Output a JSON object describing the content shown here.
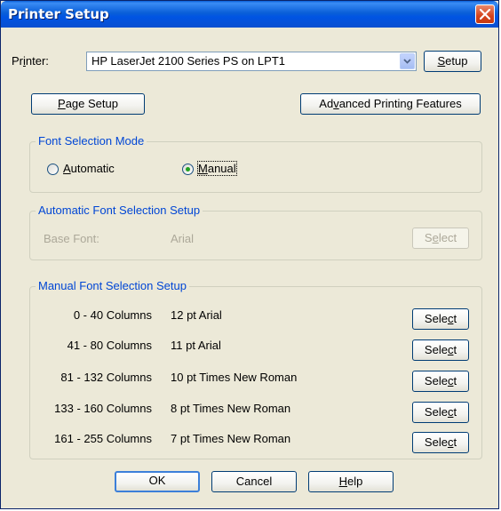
{
  "window": {
    "title": "Printer Setup"
  },
  "printer": {
    "label": "Printer:",
    "label_access": "i",
    "selected": "HP LaserJet 2100 Series PS on LPT1",
    "setup_button": "Setup"
  },
  "page_setup_button": "Page Setup",
  "advanced_button": "Advanced Printing Features",
  "font_mode": {
    "title": "Font Selection Mode",
    "options": [
      {
        "label": "Automatic",
        "selected": false
      },
      {
        "label": "Manual",
        "selected": true
      }
    ]
  },
  "auto_setup": {
    "title": "Automatic Font Selection Setup",
    "base_font_label": "Base Font:",
    "base_font_value": "Arial",
    "select_button": "Select"
  },
  "manual_setup": {
    "title": "Manual Font Selection Setup",
    "rows": [
      {
        "columns": "0 - 40 Columns",
        "font": "12 pt Arial",
        "button": "Select"
      },
      {
        "columns": "41 - 80 Columns",
        "font": "11 pt Arial",
        "button": "Select"
      },
      {
        "columns": "81 - 132 Columns",
        "font": "10 pt Times New Roman",
        "button": "Select"
      },
      {
        "columns": "133 - 160 Columns",
        "font": "8 pt Times New Roman",
        "button": "Select"
      },
      {
        "columns": "161 - 255 Columns",
        "font": "7 pt Times New Roman",
        "button": "Select"
      }
    ]
  },
  "footer": {
    "ok": "OK",
    "cancel": "Cancel",
    "help": "Help"
  }
}
